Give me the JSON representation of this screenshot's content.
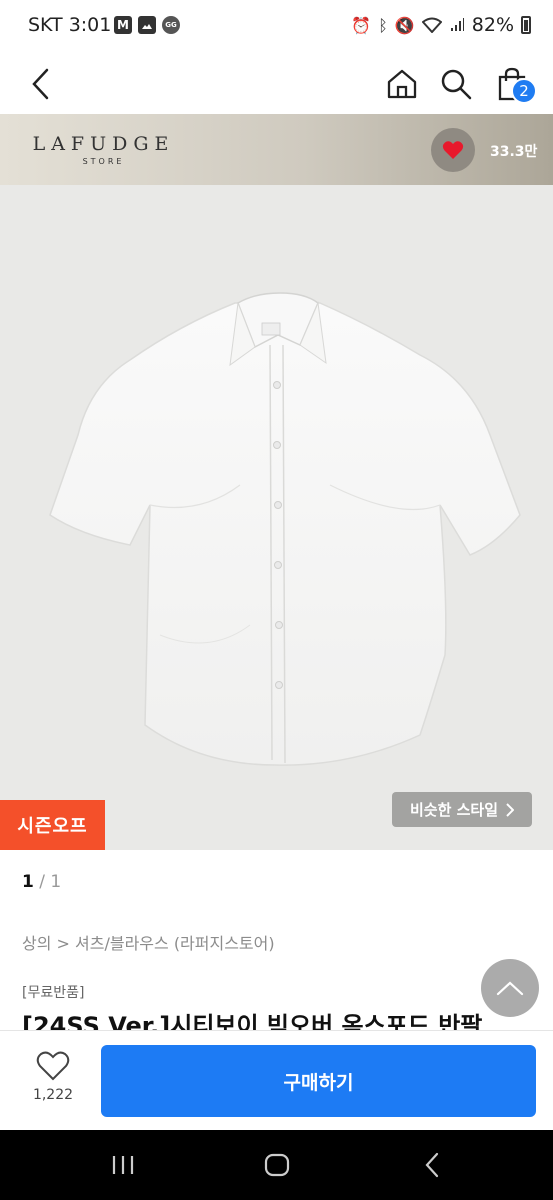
{
  "status_bar": {
    "time": "SKT 3:01",
    "left_icons": [
      "M",
      "gallery-icon",
      "OP.GG"
    ],
    "battery": "82%"
  },
  "header": {
    "cart_count": "2"
  },
  "store": {
    "logo_main": "LAFUDGE",
    "logo_sub": "STORE",
    "like_count": "33.3만"
  },
  "product": {
    "season_badge": "시즌오프",
    "similar_style_label": "비슷한 스타일",
    "pager_current": "1",
    "pager_total": "/ 1",
    "breadcrumb": "상의 > 셔츠/블라우스 (라퍼지스토어)",
    "tag": "[무료반품]",
    "title": "[24SS Ver.]시티보이 빅오버 옥스포드 반팔"
  },
  "bottom_bar": {
    "wish_count": "1,222",
    "buy_label": "구매하기"
  },
  "colors": {
    "accent_blue": "#1d7bf4",
    "season_orange": "#f4502a"
  }
}
